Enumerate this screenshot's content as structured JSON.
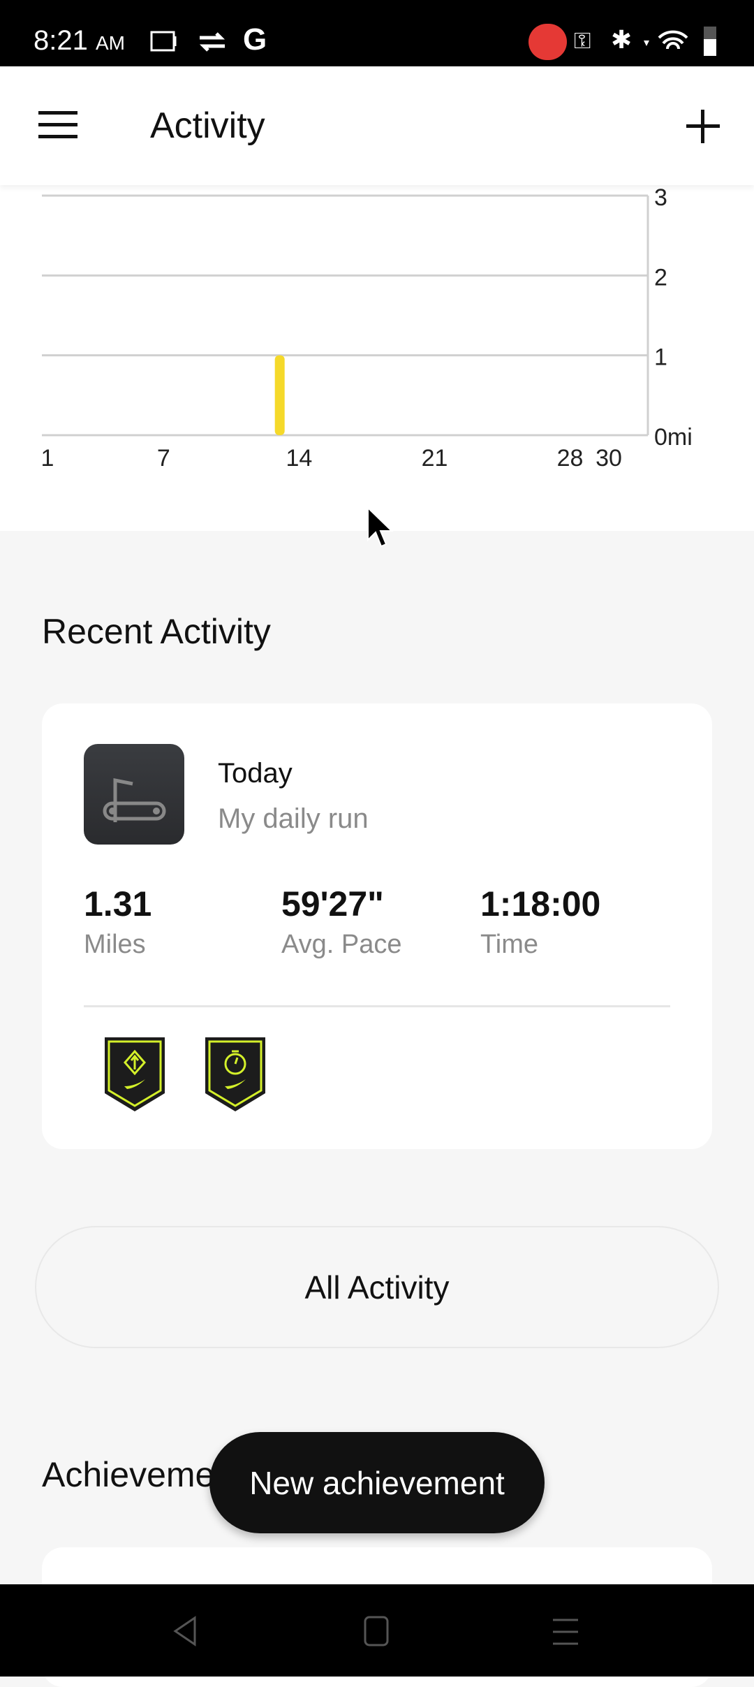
{
  "status_bar": {
    "time": "8:21",
    "ampm": "AM",
    "icons": [
      "screen-record-icon",
      "sync-icon",
      "google-icon",
      "recording-indicator-icon",
      "vpn-key-icon",
      "bluetooth-icon",
      "wifi-icon",
      "battery-icon"
    ],
    "record_color": "#e53935"
  },
  "header": {
    "title": "Activity",
    "menu_icon": "hamburger-icon",
    "add_icon": "plus-icon"
  },
  "chart_data": {
    "type": "bar",
    "x_ticks": [
      "1",
      "7",
      "14",
      "21",
      "28",
      "30"
    ],
    "y_ticks": [
      "0mi",
      "1",
      "2",
      "3"
    ],
    "xlim": [
      1,
      30
    ],
    "ylim": [
      0,
      3
    ],
    "grid": true,
    "color": "#f5d92a",
    "points": [
      {
        "x": 13,
        "y": 1.0
      }
    ]
  },
  "recent": {
    "title": "Recent Activity",
    "item": {
      "date": "Today",
      "name": "My daily run",
      "icon": "treadmill-icon",
      "stats": [
        {
          "value": "1.31",
          "label": "Miles"
        },
        {
          "value": "59'27\"",
          "label": "Avg. Pace"
        },
        {
          "value": "1:18:00",
          "label": "Time"
        }
      ],
      "badges": [
        "milestone-badge-icon",
        "stopwatch-badge-icon"
      ]
    }
  },
  "all_activity": "All Activity",
  "achievements": {
    "title": "Achievements"
  },
  "toast": "New achievement",
  "accent": "#d4f02a"
}
